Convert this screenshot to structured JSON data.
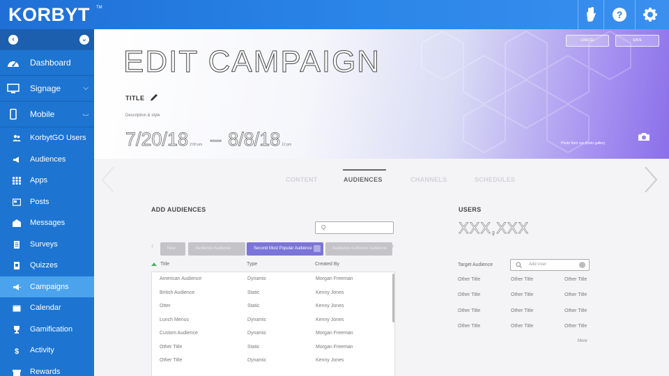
{
  "app": {
    "logo_text": "KORBYT",
    "logo_tm": "TM"
  },
  "topbar": {
    "icons": [
      "hand-icon",
      "help-icon",
      "gear-icon"
    ]
  },
  "sidebar": {
    "items": [
      {
        "label": "Dashboard",
        "icon": "dashboard-icon"
      },
      {
        "label": "Signage",
        "icon": "monitor-icon",
        "chevron": "down"
      },
      {
        "label": "Mobile",
        "icon": "mobile-icon",
        "chevron": "up"
      }
    ],
    "sub_items": [
      {
        "label": "KorbytGO Users",
        "icon": "users-icon"
      },
      {
        "label": "Audiences",
        "icon": "megaphone-icon"
      },
      {
        "label": "Apps",
        "icon": "apps-icon"
      },
      {
        "label": "Posts",
        "icon": "posts-icon"
      },
      {
        "label": "Messages",
        "icon": "messages-icon"
      },
      {
        "label": "Surveys",
        "icon": "surveys-icon"
      },
      {
        "label": "Quizzes",
        "icon": "quizzes-icon"
      },
      {
        "label": "Campaigns",
        "icon": "campaigns-icon",
        "active": true
      },
      {
        "label": "Calendar",
        "icon": "calendar-icon"
      },
      {
        "label": "Gamification",
        "icon": "gamification-icon"
      },
      {
        "label": "Activity",
        "icon": "activity-icon"
      },
      {
        "label": "Rewards",
        "icon": "rewards-icon"
      }
    ]
  },
  "header": {
    "title": "EDIT CAMPAIGN",
    "title_label": "TITLE",
    "description": "Description & style",
    "start_date": "7/20/18",
    "start_time": "2:00 pm",
    "end_date": "8/8/18",
    "end_time": "12 pm",
    "cancel_label": "CANCEL",
    "save_label": "SAVE",
    "image_credit": "Photo from our photo gallery"
  },
  "tabs": [
    "CONTENT",
    "AUDIENCES",
    "CHANNELS",
    "SCHEDULES"
  ],
  "add_audiences": {
    "title": "ADD AUDIENCES",
    "search_value": "Q",
    "chips": [
      "New",
      "Audience Audience",
      "Second Most Popular Audience",
      "Audience Audience Audience"
    ],
    "columns": [
      "Title",
      "Type",
      "Created By"
    ],
    "rows": [
      [
        "American Audience",
        "Dynamic",
        "Morgan Freeman"
      ],
      [
        "British Audience",
        "Static",
        "Kenny Jones"
      ],
      [
        "Otter",
        "Static",
        "Kenny Jones"
      ],
      [
        "Lunch Menus",
        "Dynamic",
        "Kenny Jones"
      ],
      [
        "Custom Audience",
        "Dynamic",
        "Morgan Freeman"
      ],
      [
        "Other Title",
        "Static",
        "Morgan Freeman"
      ],
      [
        "Other Title",
        "Dynamic",
        "Kenny Jones"
      ]
    ]
  },
  "users": {
    "title": "USERS",
    "count": "XXX,XXX",
    "target_label": "Target Audience",
    "search_placeholder": "Add User",
    "grid": [
      [
        "Other Title",
        "Other Title",
        "Other Title"
      ],
      [
        "Other Title",
        "Other Title",
        "Other Title"
      ],
      [
        "Other Title",
        "Other Title",
        "Other Title"
      ],
      [
        "Other Title",
        "Other Title",
        "Other Title"
      ]
    ],
    "more_label": "More"
  },
  "colors": {
    "brand": "#1f6fd6",
    "sidebar": "#1d74d1",
    "active_item": "#4ba3ee",
    "chip_active": "#7b74d9"
  }
}
